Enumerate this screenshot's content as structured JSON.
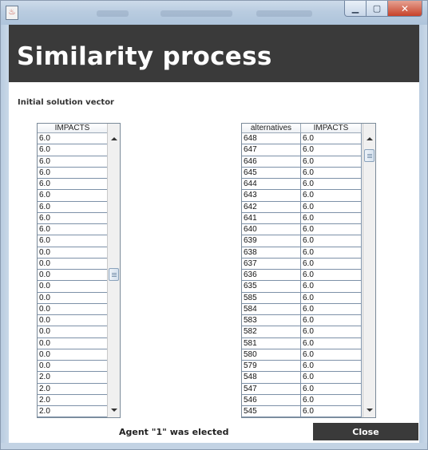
{
  "window": {
    "icon": "java-icon",
    "controls": {
      "minimize": "minimize-icon",
      "maximize": "maximize-icon",
      "close": "close-icon"
    }
  },
  "header": {
    "title": "Similarity process"
  },
  "section_label": "Initial solution vector",
  "left_table": {
    "columns": [
      "IMPACTS"
    ],
    "rows": [
      "6.0",
      "6.0",
      "6.0",
      "6.0",
      "6.0",
      "6.0",
      "6.0",
      "6.0",
      "6.0",
      "6.0",
      "0.0",
      "0.0",
      "0.0",
      "0.0",
      "0.0",
      "0.0",
      "0.0",
      "0.0",
      "0.0",
      "0.0",
      "0.0",
      "2.0",
      "2.0",
      "2.0",
      "2.0"
    ],
    "scroll_position": 0.5
  },
  "right_table": {
    "columns": [
      "alternatives",
      "IMPACTS"
    ],
    "rows": [
      [
        "648",
        "6.0"
      ],
      [
        "647",
        "6.0"
      ],
      [
        "646",
        "6.0"
      ],
      [
        "645",
        "6.0"
      ],
      [
        "644",
        "6.0"
      ],
      [
        "643",
        "6.0"
      ],
      [
        "642",
        "6.0"
      ],
      [
        "641",
        "6.0"
      ],
      [
        "640",
        "6.0"
      ],
      [
        "639",
        "6.0"
      ],
      [
        "638",
        "6.0"
      ],
      [
        "637",
        "6.0"
      ],
      [
        "636",
        "6.0"
      ],
      [
        "635",
        "6.0"
      ],
      [
        "585",
        "6.0"
      ],
      [
        "584",
        "6.0"
      ],
      [
        "583",
        "6.0"
      ],
      [
        "582",
        "6.0"
      ],
      [
        "581",
        "6.0"
      ],
      [
        "580",
        "6.0"
      ],
      [
        "579",
        "6.0"
      ],
      [
        "548",
        "6.0"
      ],
      [
        "547",
        "6.0"
      ],
      [
        "546",
        "6.0"
      ],
      [
        "545",
        "6.0"
      ]
    ],
    "scroll_position": 0.02
  },
  "footer": {
    "status": "Agent \"1\" was elected",
    "close_label": "Close"
  },
  "colors": {
    "header_band": "#3a3a3a",
    "header_text": "#ffffff",
    "close_button": "#3a3a3a",
    "grid_line": "#7d91a8"
  }
}
